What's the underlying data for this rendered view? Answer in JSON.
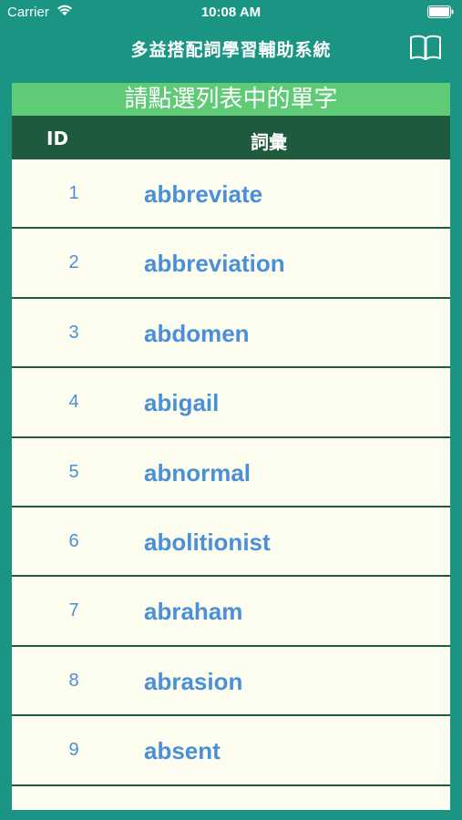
{
  "status": {
    "carrier": "Carrier",
    "time": "10:08 AM"
  },
  "nav": {
    "title": "多益搭配詞學習輔助系統",
    "book_icon": "book-icon"
  },
  "list": {
    "header": "請點選列表中的單字",
    "col_id": "ID",
    "col_word": "詞彙",
    "rows": [
      {
        "id": "1",
        "word": "abbreviate"
      },
      {
        "id": "2",
        "word": "abbreviation"
      },
      {
        "id": "3",
        "word": "abdomen"
      },
      {
        "id": "4",
        "word": "abigail"
      },
      {
        "id": "5",
        "word": "abnormal"
      },
      {
        "id": "6",
        "word": "abolitionist"
      },
      {
        "id": "7",
        "word": "abraham"
      },
      {
        "id": "8",
        "word": "abrasion"
      },
      {
        "id": "9",
        "word": "absent"
      }
    ]
  },
  "colors": {
    "background": "#1a9583",
    "header_green": "#5fcb77",
    "column_header": "#1f5a3d",
    "row_background": "#fdfdf0",
    "text_blue": "#4a90d9"
  }
}
